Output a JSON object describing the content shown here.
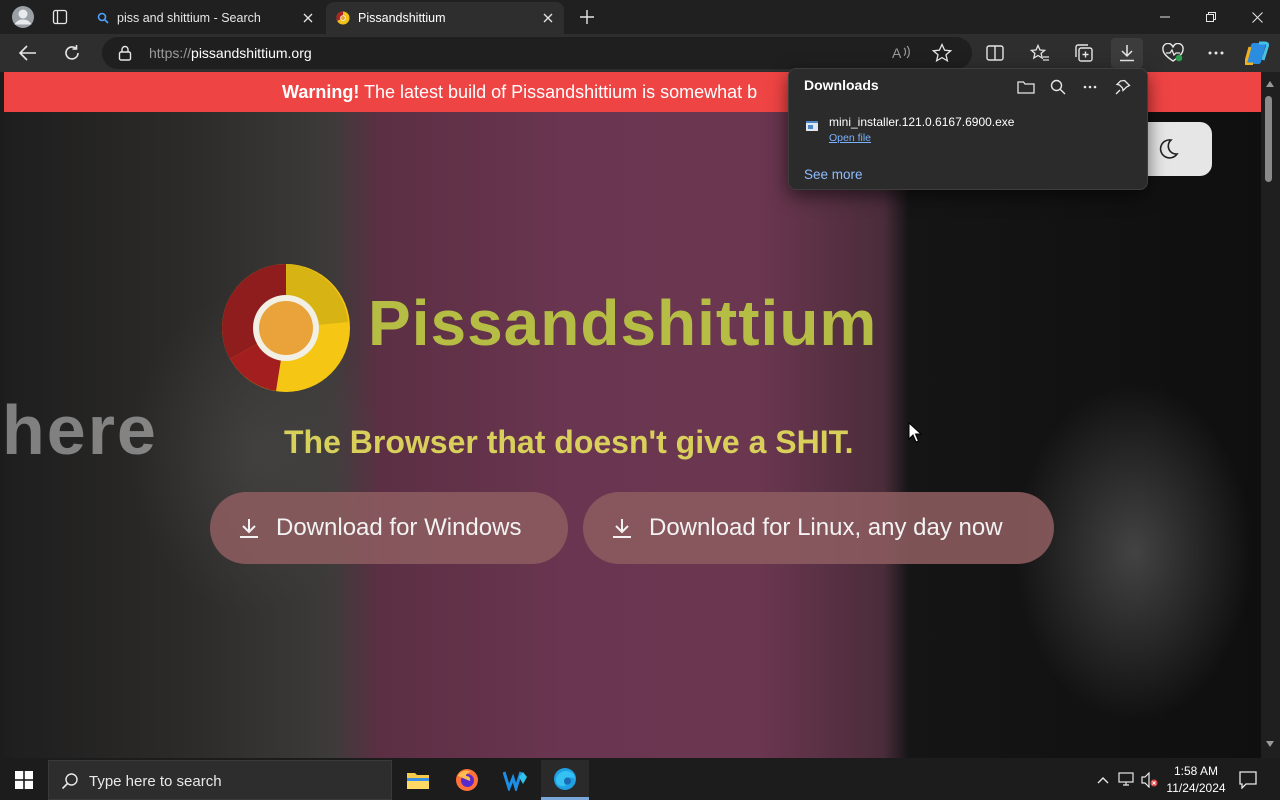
{
  "browser": {
    "tabs": [
      {
        "title": "piss and shittium - Search",
        "active": false,
        "favicon": "search-favicon"
      },
      {
        "title": "Pissandshittium",
        "active": true,
        "favicon": "pissandshittium-favicon"
      }
    ],
    "address": {
      "scheme": "https://",
      "host": "pissandshittium.org"
    },
    "toolbar_icons": [
      "read-aloud-icon",
      "favorite-star-icon",
      "split-screen-icon",
      "favorites-icon",
      "collections-icon",
      "downloads-icon",
      "browser-essentials-icon",
      "more-icon",
      "copilot-icon"
    ]
  },
  "downloads_panel": {
    "title": "Downloads",
    "items": [
      {
        "filename": "mini_installer.121.0.6167.6900.exe",
        "action": "Open file"
      }
    ],
    "see_more": "See more"
  },
  "page": {
    "warning": {
      "bold": "Warning!",
      "text": " The latest build of Pissandshittium is somewhat b"
    },
    "background_text": "here",
    "brand": "Pissandshittium",
    "tagline": "The Browser that doesn't give a SHIT.",
    "buttons": {
      "windows": "Download for Windows",
      "linux": "Download for Linux, any day now"
    }
  },
  "taskbar": {
    "search_placeholder": "Type here to search",
    "apps": [
      "file-explorer-icon",
      "firefox-icon",
      "waterfox-icon",
      "edge-icon"
    ],
    "clock": {
      "time": "1:58 AM",
      "date": "11/24/2024"
    }
  },
  "colors": {
    "warning_bg": "#ef4444",
    "brand": "#b5bd44",
    "tagline": "#d8d05a",
    "button_bg": "#8c5c60",
    "link": "#8fbcff"
  }
}
